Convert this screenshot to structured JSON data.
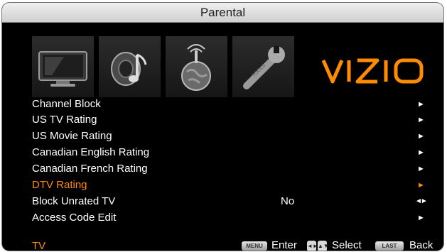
{
  "window": {
    "title": "Parental"
  },
  "icons": [
    {
      "name": "tv-icon"
    },
    {
      "name": "music-icon"
    },
    {
      "name": "network-globe-icon"
    },
    {
      "name": "tools-icon"
    }
  ],
  "brand": {
    "logo_text": "VIZIO",
    "color": "#ff8c00"
  },
  "menu": {
    "items": [
      {
        "label": "Channel Block",
        "arrow": "►"
      },
      {
        "label": "US TV Rating",
        "arrow": "►"
      },
      {
        "label": "US Movie Rating",
        "arrow": "►"
      },
      {
        "label": "Canadian English Rating",
        "arrow": "►"
      },
      {
        "label": "Canadian French Rating",
        "arrow": "►"
      },
      {
        "label": "DTV Rating",
        "arrow": "►",
        "active": true
      },
      {
        "label": "Block Unrated TV",
        "value": "No",
        "arrow": "◄►"
      },
      {
        "label": "Access Code Edit",
        "arrow": "►"
      }
    ]
  },
  "footer": {
    "source": "TV",
    "menu_key": "MENU",
    "enter_label": "Enter",
    "select_label": "Select",
    "last_key": "LAST",
    "back_label": "Back"
  },
  "colors": {
    "highlight": "#ff8c00",
    "background": "#000000",
    "title_bar": "#dcdcdc"
  }
}
